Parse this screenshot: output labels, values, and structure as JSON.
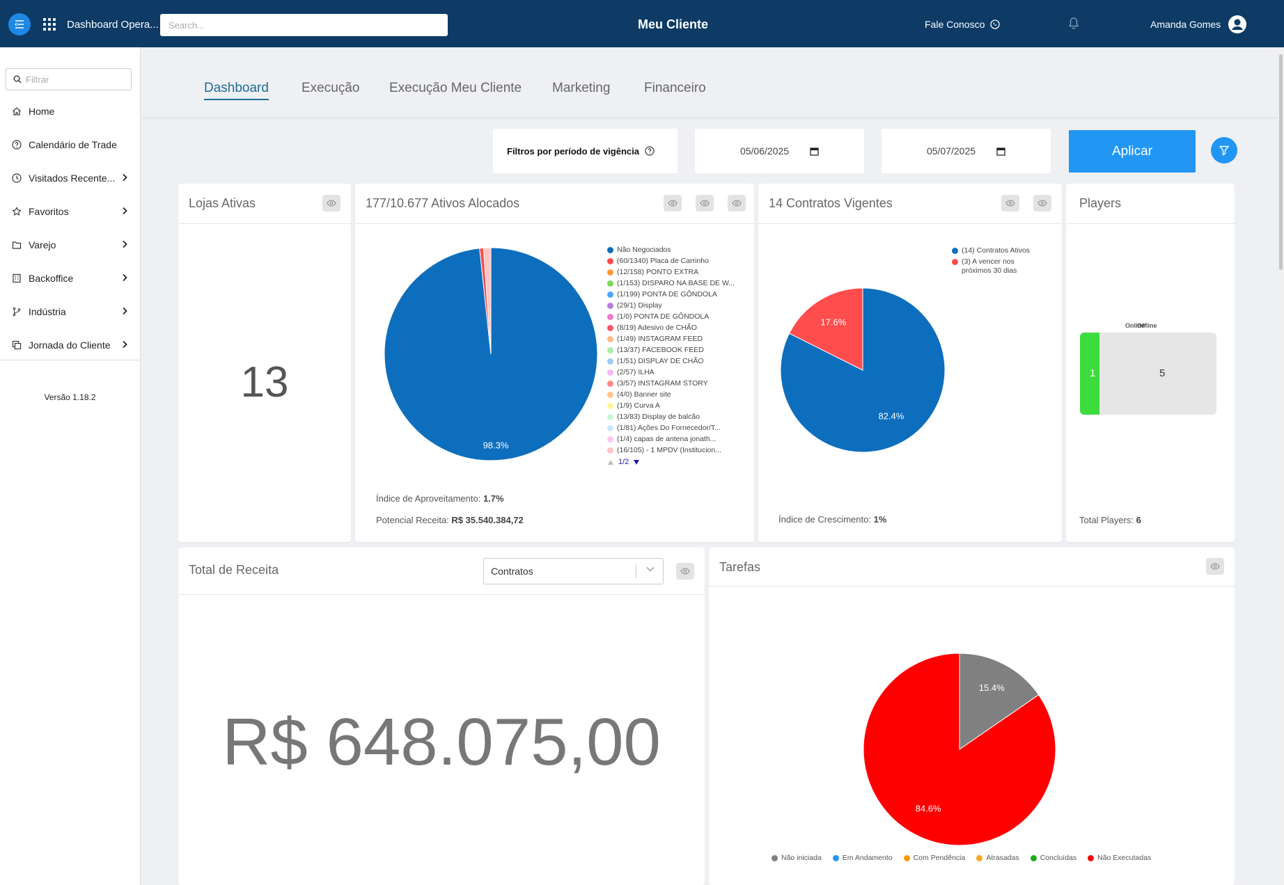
{
  "topbar": {
    "app_title": "Dashboard Opera...",
    "search_placeholder": "Search...",
    "brand": "Meu Cliente",
    "contact": "Fale Conosco",
    "user_name": "Amanda Gomes"
  },
  "sidebar": {
    "filter_placeholder": "Filtrar",
    "items": [
      {
        "label": "Home",
        "icon": "home-icon",
        "has_submenu": false
      },
      {
        "label": "Calendário de Trade",
        "icon": "help-circle-icon",
        "has_submenu": false
      },
      {
        "label": "Visitados Recente...",
        "icon": "clock-icon",
        "has_submenu": true
      },
      {
        "label": "Favoritos",
        "icon": "star-icon",
        "has_submenu": true
      },
      {
        "label": "Varejo",
        "icon": "folder-icon",
        "has_submenu": true
      },
      {
        "label": "Backoffice",
        "icon": "building-icon",
        "has_submenu": true
      },
      {
        "label": "Indústria",
        "icon": "branch-icon",
        "has_submenu": true
      },
      {
        "label": "Jornada do Cliente",
        "icon": "copy-icon",
        "has_submenu": true
      }
    ],
    "version": "Versão 1.18.2"
  },
  "tabs": [
    {
      "label": "Dashboard",
      "active": true
    },
    {
      "label": "Execução",
      "active": false
    },
    {
      "label": "Execução Meu Cliente",
      "active": false
    },
    {
      "label": "Marketing",
      "active": false
    },
    {
      "label": "Financeiro",
      "active": false
    }
  ],
  "filters": {
    "period_label": "Filtros por período de vigência",
    "date_from": "05/06/2025",
    "date_to": "05/07/2025",
    "apply_label": "Aplicar"
  },
  "cards": {
    "lojas": {
      "title": "Lojas Ativas",
      "value": "13"
    },
    "ativos": {
      "title": "177/10.677 Ativos Alocados",
      "legend": [
        {
          "label": "Não Negociados",
          "color": "#0d6ebd"
        },
        {
          "label": "(60/1340) Placa de Carrinho",
          "color": "#ff4d4d"
        },
        {
          "label": "(12/158) PONTO EXTRA",
          "color": "#ff9933"
        },
        {
          "label": "(1/153) DISPARO NA BASE DE W...",
          "color": "#7ed957"
        },
        {
          "label": "(1/199) PONTA DE GÔNDOLA",
          "color": "#4da6ff"
        },
        {
          "label": "(29/1) Display",
          "color": "#b57edc"
        },
        {
          "label": "(1/0) PONTA DE GÔNDOLA",
          "color": "#f07ad0"
        },
        {
          "label": "(8/19) Adesivo de CHÃO",
          "color": "#ff5566"
        },
        {
          "label": "(1/49) INSTAGRAM FEED",
          "color": "#ffbb88"
        },
        {
          "label": "(13/37) FACEBOOK FEED",
          "color": "#a8ecb0"
        },
        {
          "label": "(1/51) DISPLAY DE CHÃO",
          "color": "#9cccf5"
        },
        {
          "label": "(2/57) ILHA",
          "color": "#f5b8f0"
        },
        {
          "label": "(3/57) INSTAGRAM STORY",
          "color": "#ff8888"
        },
        {
          "label": "(4/0) Banner site",
          "color": "#ffc58a"
        },
        {
          "label": "(1/9) Curva A",
          "color": "#fff59a"
        },
        {
          "label": "(13/83) Display de balcão",
          "color": "#c9f5d8"
        },
        {
          "label": "(1/81) Ações Do Fornecedor/T...",
          "color": "#cde6fa"
        },
        {
          "label": "(1/4) capas de antena jonath...",
          "color": "#f7c8f3"
        },
        {
          "label": "(16/105) - 1 MPDV (Institucion...",
          "color": "#ffc4c4"
        }
      ],
      "pager": "1/2",
      "index_label": "Índice de Aproveitamento:",
      "index_value": "1.7%",
      "revenue_label": "Potencial Receita:",
      "revenue_value": "R$ 35.540.384,72"
    },
    "contratos": {
      "title": "14 Contratos Vigentes",
      "legend": [
        {
          "label": "(14) Contratos Ativos",
          "color": "#0d6ebd"
        },
        {
          "label": "(3) A vencer nos",
          "color": "#ff4d4d"
        }
      ],
      "legend_cont": "próximos 30 dias",
      "growth_label": "Índice de Crescimento:",
      "growth_value": "1%"
    },
    "players": {
      "title": "Players",
      "online_label": "Online",
      "offline_label": "Offline",
      "online": "1",
      "offline": "5",
      "total_label": "Total Players:",
      "total_value": "6"
    },
    "receita": {
      "title": "Total de Receita",
      "select_value": "Contratos",
      "value": "R$ 648.075,00"
    },
    "tarefas": {
      "title": "Tarefas",
      "legend": [
        {
          "label": "Não iniciada",
          "color": "#808080"
        },
        {
          "label": "Em Andamento",
          "color": "#2196f3"
        },
        {
          "label": "Com Pendência",
          "color": "#ff9800"
        },
        {
          "label": "Atrasadas",
          "color": "#f5a623"
        },
        {
          "label": "Concluídas",
          "color": "#1aaa1a"
        },
        {
          "label": "Não Executadas",
          "color": "#ff0000"
        }
      ]
    }
  },
  "chart_data": [
    {
      "type": "pie",
      "title": "177/10.677 Ativos Alocados",
      "series": [
        {
          "values": [
            {
              "label": "Não Negociados",
              "value": 98.3,
              "color": "#0d6ebd"
            },
            {
              "label": "(60/1340) Placa de Carrinho",
              "value": 0.6,
              "color": "#ff4d4d"
            },
            {
              "label": "Outros",
              "value": 1.1,
              "color": "#ffc4c4"
            }
          ]
        }
      ],
      "slice_labels": [
        "98.3%"
      ]
    },
    {
      "type": "pie",
      "title": "14 Contratos Vigentes",
      "series": [
        {
          "values": [
            {
              "label": "(14) Contratos Ativos",
              "value": 82.4,
              "color": "#0d6ebd"
            },
            {
              "label": "(3) A vencer nos próximos 30 dias",
              "value": 17.6,
              "color": "#ff4d4d"
            }
          ]
        }
      ],
      "slice_labels": [
        "82.4%",
        "17.6%"
      ]
    },
    {
      "type": "pie",
      "title": "Tarefas",
      "series": [
        {
          "values": [
            {
              "label": "Não iniciada",
              "value": 15.4,
              "color": "#808080"
            },
            {
              "label": "Não Executadas",
              "value": 84.6,
              "color": "#ff0000"
            }
          ]
        }
      ],
      "slice_labels": [
        "15.4%",
        "84.6%"
      ]
    }
  ]
}
